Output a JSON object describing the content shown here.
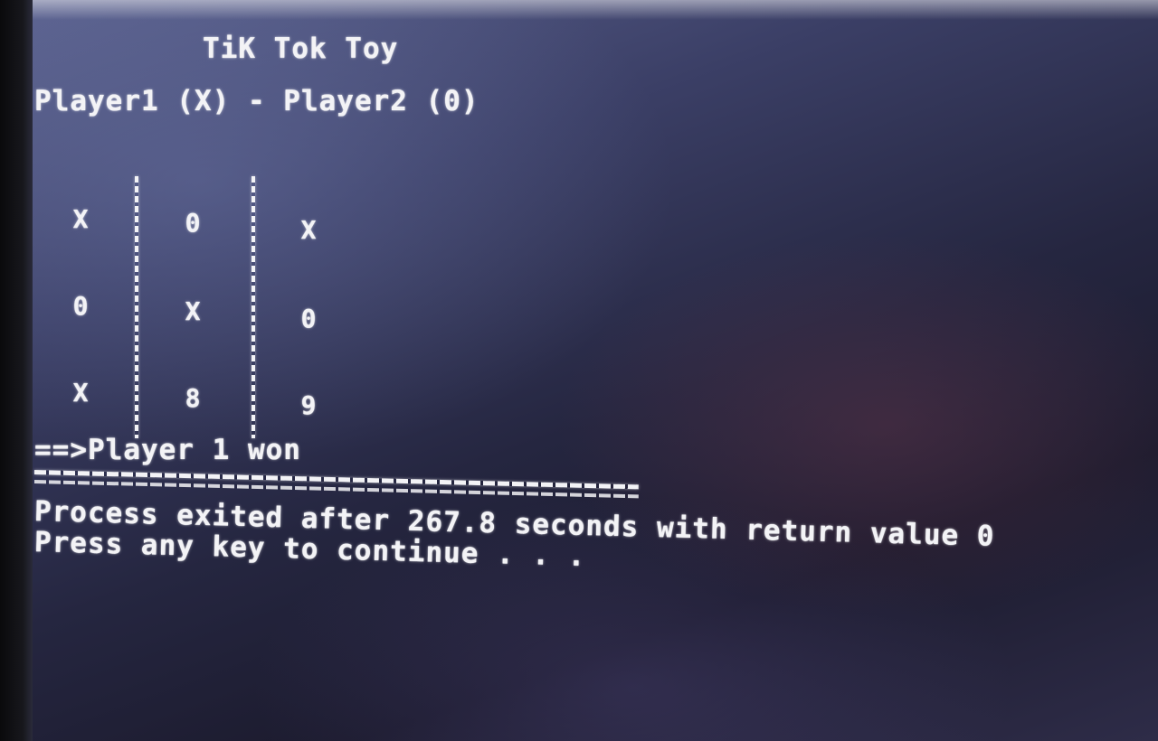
{
  "console": {
    "title": "TiK Tok Toy",
    "players_line": "Player1 (X) - Player2 (0)",
    "board": [
      [
        "X",
        "0",
        "X"
      ],
      [
        "0",
        "X",
        "0"
      ],
      [
        "X",
        "8",
        "9"
      ]
    ],
    "result_line": "==>Player 1 won",
    "process_line": "Process exited after 267.8 seconds with return value 0",
    "continue_line": "Press any key to continue . . ."
  }
}
